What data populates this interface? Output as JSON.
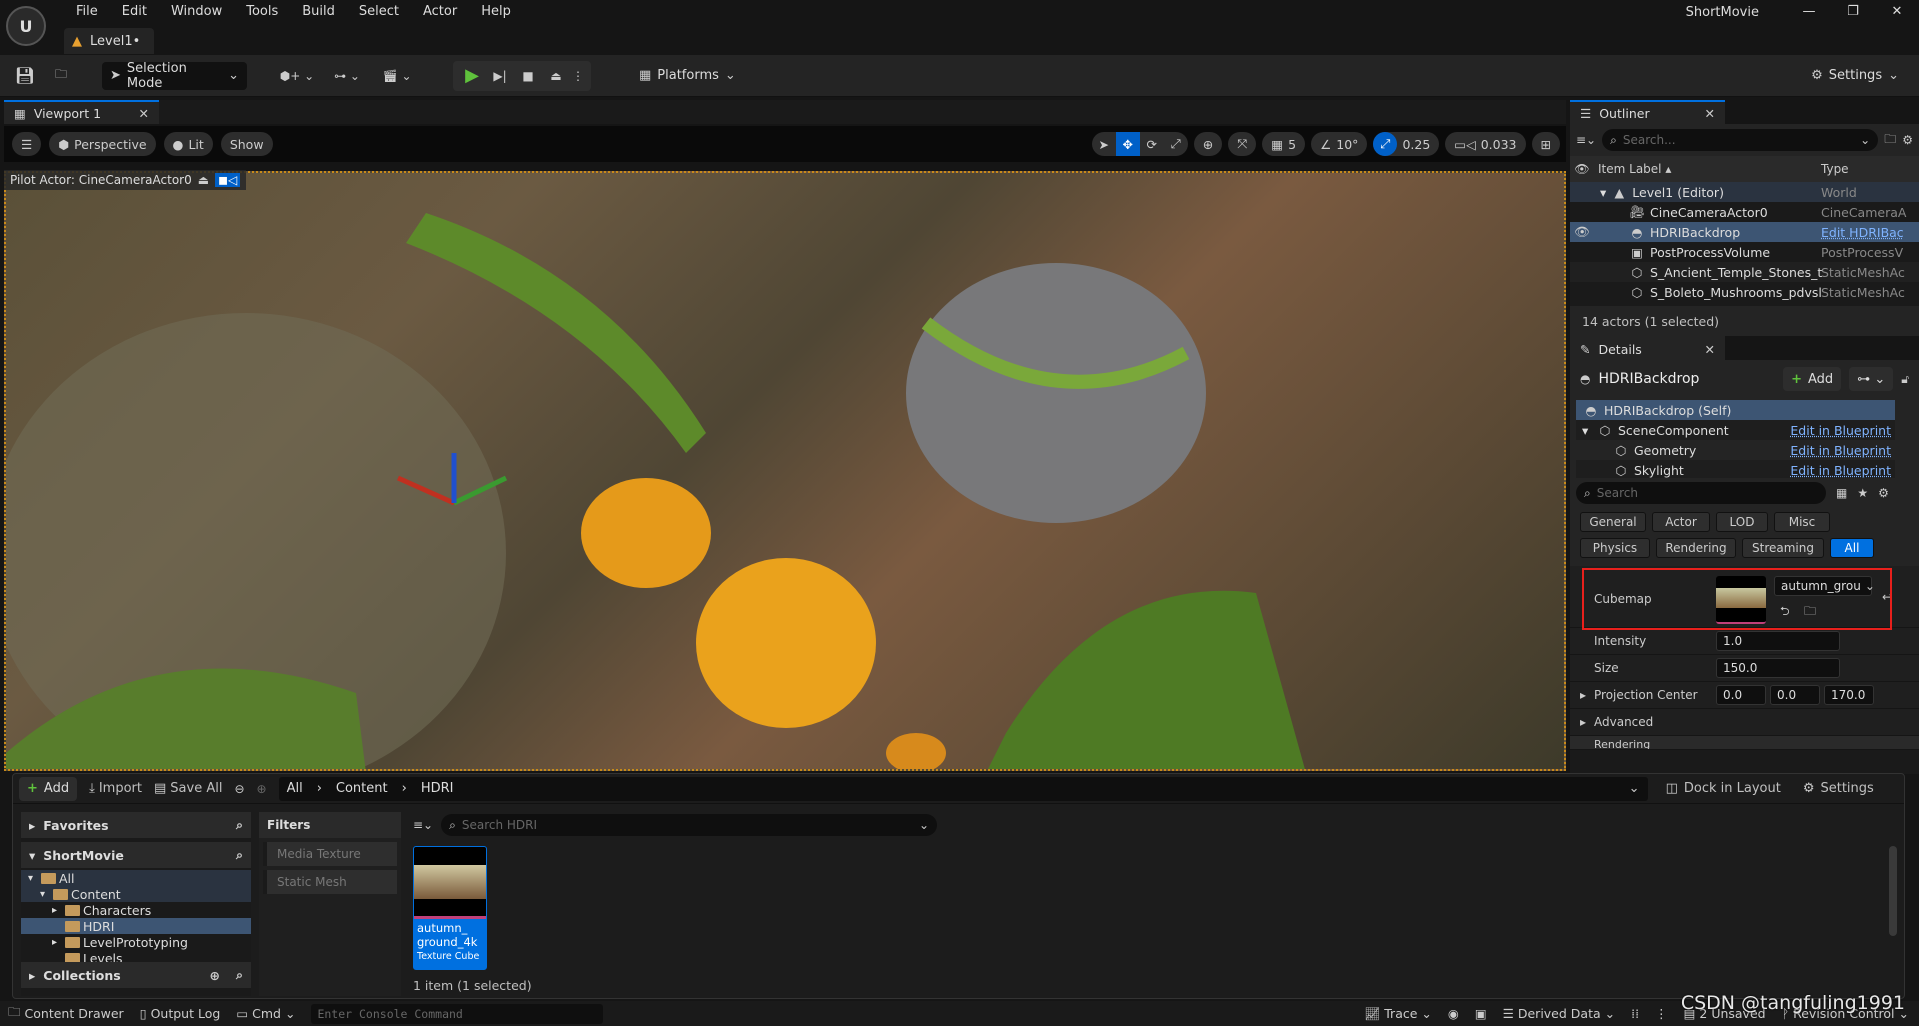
{
  "app": {
    "logo_text": "U",
    "project_title": "ShortMovie",
    "level_tab": "Level1•",
    "menu": [
      "File",
      "Edit",
      "Window",
      "Tools",
      "Build",
      "Select",
      "Actor",
      "Help"
    ],
    "window_controls": [
      "—",
      "❐",
      "✕"
    ]
  },
  "toolbar": {
    "selection_mode": "Selection Mode",
    "platforms": "Platforms",
    "settings": "Settings"
  },
  "viewport": {
    "tab": "Viewport 1",
    "perspective": "Perspective",
    "lit": "Lit",
    "show": "Show",
    "pilot_actor": "Pilot Actor: CineCameraActor0",
    "grid_size": "5",
    "rotation_snap": "10°",
    "scale_snap": "0.25",
    "camera_speed": "0.033"
  },
  "outliner": {
    "tab": "Outliner",
    "search_placeholder": "Search...",
    "col_label": "Item Label",
    "col_type": "Type",
    "rows": [
      {
        "label": "Level1 (Editor)",
        "type": "World",
        "type_link": false
      },
      {
        "label": "CineCameraActor0",
        "type": "CineCameraA",
        "type_link": false
      },
      {
        "label": "HDRIBackdrop",
        "type": "Edit HDRIBac",
        "type_link": true
      },
      {
        "label": "PostProcessVolume",
        "type": "PostProcessV",
        "type_link": false
      },
      {
        "label": "S_Ancient_Temple_Stones_t",
        "type": "StaticMeshAc",
        "type_link": false
      },
      {
        "label": "S_Boleto_Mushrooms_pdvsl",
        "type": "StaticMeshAc",
        "type_link": false
      }
    ],
    "footer": "14 actors (1 selected)"
  },
  "details": {
    "tab": "Details",
    "actor": "HDRIBackdrop",
    "add": "Add",
    "components": [
      {
        "label": "HDRIBackdrop (Self)",
        "link": ""
      },
      {
        "label": "SceneComponent",
        "link": "Edit in Blueprint"
      },
      {
        "label": "Geometry",
        "link": "Edit in Blueprint"
      },
      {
        "label": "Skylight",
        "link": "Edit in Blueprint"
      }
    ],
    "search_placeholder": "Search",
    "filters_row1": [
      "General",
      "Actor",
      "LOD",
      "Misc"
    ],
    "filters_row2": [
      "Physics",
      "Rendering",
      "Streaming",
      "All"
    ],
    "active_filter": "All",
    "cubemap_label": "Cubemap",
    "cubemap_value": "autumn_grou",
    "intensity_label": "Intensity",
    "intensity": "1.0",
    "size_label": "Size",
    "size": "150.0",
    "projection_label": "Projection Center",
    "projection": [
      "0.0",
      "0.0",
      "170.0"
    ],
    "advanced": "Advanced",
    "rendering": "Rendering",
    "highlight_color": "#e8201c"
  },
  "drawer": {
    "add": "Add",
    "import": "Import",
    "save_all": "Save All",
    "path": [
      "All",
      "Content",
      "HDRI"
    ],
    "dock": "Dock in Layout",
    "settings": "Settings",
    "favorites": "Favorites",
    "project": "ShortMovie",
    "collections": "Collections",
    "tree": [
      {
        "label": "All",
        "depth": 0
      },
      {
        "label": "Content",
        "depth": 1
      },
      {
        "label": "Characters",
        "depth": 2
      },
      {
        "label": "HDRI",
        "depth": 2
      },
      {
        "label": "LevelPrototyping",
        "depth": 2
      },
      {
        "label": "Levels",
        "depth": 2
      }
    ],
    "filters_title": "Filters",
    "filters": [
      "Media Texture",
      "Static Mesh"
    ],
    "search_placeholder": "Search HDRI",
    "asset": {
      "name": "autumn_ ground_4k",
      "type": "Texture Cube"
    },
    "count": "1 item (1 selected)"
  },
  "status": {
    "content_drawer": "Content Drawer",
    "output_log": "Output Log",
    "cmd": "Cmd",
    "console_placeholder": "Enter Console Command",
    "trace": "Trace",
    "derived_data": "Derived Data",
    "unsaved": "2 Unsaved",
    "revision": "Revision Control",
    "watermark": "CSDN @tangfuling1991"
  },
  "colors": {
    "accent": "#0070e0",
    "selected_row": "#3d5573",
    "link": "#7fb3ff"
  }
}
